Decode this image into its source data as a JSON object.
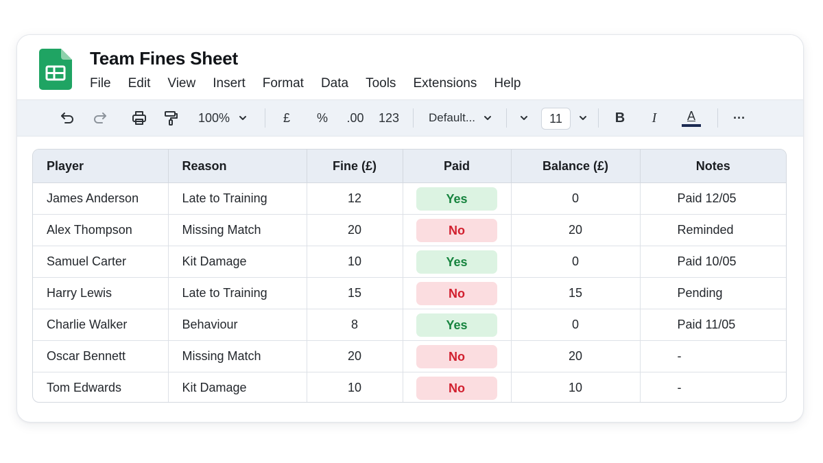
{
  "app": {
    "title": "Team Fines Sheet",
    "logo_icon": "google-sheets-icon",
    "brand_color": "#1fa463"
  },
  "menu": [
    "File",
    "Edit",
    "View",
    "Insert",
    "Format",
    "Data",
    "Tools",
    "Extensions",
    "Help"
  ],
  "toolbar": {
    "zoom": "100%",
    "currency_label": "£",
    "percent_label": "%",
    "decimal_label": ".00",
    "number_format_label": "123",
    "font_label": "Default...",
    "font_size": "11",
    "bold_label": "B",
    "italic_label": "I",
    "text_color_label": "A",
    "text_color": "#1b2a52",
    "more_label": "···"
  },
  "table": {
    "columns": [
      "Player",
      "Reason",
      "Fine (£)",
      "Paid",
      "Balance (£)",
      "Notes"
    ],
    "rows": [
      {
        "player": "James Anderson",
        "reason": "Late to Training",
        "fine": "12",
        "paid": "Yes",
        "balance": "0",
        "notes": "Paid 12/05"
      },
      {
        "player": "Alex Thompson",
        "reason": "Missing Match",
        "fine": "20",
        "paid": "No",
        "balance": "20",
        "notes": "Reminded"
      },
      {
        "player": "Samuel Carter",
        "reason": "Kit Damage",
        "fine": "10",
        "paid": "Yes",
        "balance": "0",
        "notes": "Paid 10/05"
      },
      {
        "player": "Harry Lewis",
        "reason": "Late to Training",
        "fine": "15",
        "paid": "No",
        "balance": "15",
        "notes": "Pending"
      },
      {
        "player": "Charlie Walker",
        "reason": "Behaviour",
        "fine": "8",
        "paid": "Yes",
        "balance": "0",
        "notes": "Paid 11/05"
      },
      {
        "player": "Oscar Bennett",
        "reason": "Missing Match",
        "fine": "20",
        "paid": "No",
        "balance": "20",
        "notes": "-"
      },
      {
        "player": "Tom Edwards",
        "reason": "Kit Damage",
        "fine": "10",
        "paid": "No",
        "balance": "10",
        "notes": "-"
      }
    ]
  },
  "colors": {
    "paid_yes_bg": "#dcf3e2",
    "paid_yes_text": "#17843f",
    "paid_no_bg": "#fbdde0",
    "paid_no_text": "#d11f2e"
  }
}
